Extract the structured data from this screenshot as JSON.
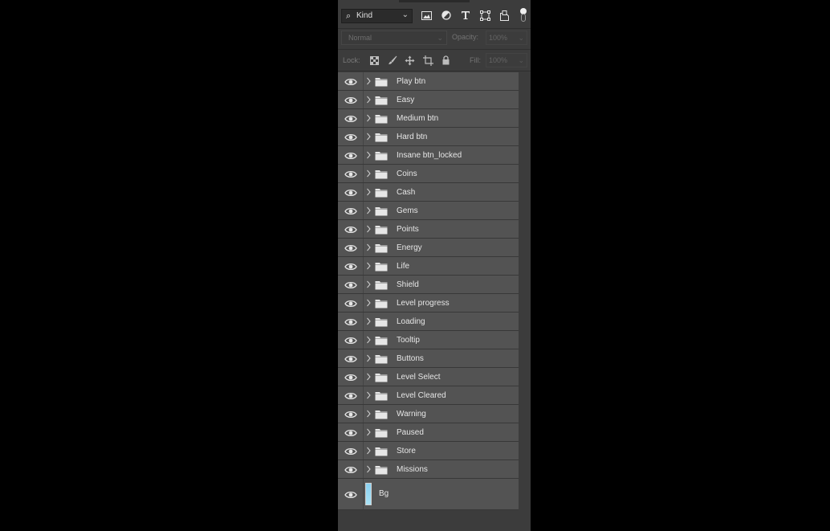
{
  "filter": {
    "kind_label": "Kind",
    "kind_icon": "search-icon",
    "icons": [
      "image-filter-icon",
      "adjustment-filter-icon",
      "type-filter-icon",
      "shape-filter-icon",
      "smart-object-filter-icon"
    ]
  },
  "blend": {
    "mode": "Normal",
    "opacity_label": "Opacity:",
    "opacity_value": "100%"
  },
  "lock": {
    "label": "Lock:",
    "fill_label": "Fill:",
    "fill_value": "100%"
  },
  "layers": [
    {
      "name": "Play btn"
    },
    {
      "name": "Easy"
    },
    {
      "name": "Medium btn"
    },
    {
      "name": "Hard btn"
    },
    {
      "name": "Insane btn_locked"
    },
    {
      "name": "Coins"
    },
    {
      "name": "Cash"
    },
    {
      "name": "Gems"
    },
    {
      "name": "Points"
    },
    {
      "name": "Energy"
    },
    {
      "name": "Life"
    },
    {
      "name": "Shield"
    },
    {
      "name": "Level progress"
    },
    {
      "name": "Loading"
    },
    {
      "name": "Tooltip"
    },
    {
      "name": "Buttons"
    },
    {
      "name": "Level Select"
    },
    {
      "name": "Level Cleared"
    },
    {
      "name": "Warning"
    },
    {
      "name": "Paused"
    },
    {
      "name": "Store"
    },
    {
      "name": "Missions"
    }
  ],
  "background_layer": {
    "name": "Bg"
  },
  "colors": {
    "panel": "#3c3c3c",
    "row": "#535353",
    "text": "#e6e6e6",
    "bg_thumb": "#a9e2f5"
  }
}
